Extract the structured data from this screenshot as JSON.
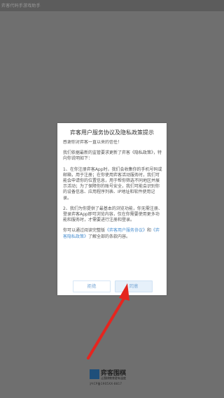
{
  "status_bar": {
    "text": "弈客代码手游戏助手"
  },
  "dialog": {
    "title": "弈客用户服务协议及隐私政策提示",
    "greeting": "感谢你对弈客一直以来的信任！",
    "intro": "我们依据最新的监管要求更新了弈客《隐私政策》，特向你说明如下：",
    "item1": "1、在你注册弈客App时，我们会收集你的手机号码或邮箱，用于注册；在你使用弈客活动服务时，我们可能会申请你的位置信息，用于帮你筛选不同地区并展示活动；为了保障你的账号安全，我们可能会识别你的设备信息、应用程序列表、IP地址和软件使用记录。",
    "item2": "2、我们为你提供了最基本的浏览功能，你无需注册、登录弈客App即可浏览内容，仅在你需要使用更多功能和服务时，才需要进行注册和登录。",
    "outro_prefix": "你可以通过阅读完整版",
    "outro_link1": "《弈客用户服务协议》",
    "outro_and": "和",
    "outro_link2": "《弈客隐私政策》",
    "outro_suffix": "了解全部的条款内容。",
    "reject_label": "拒绝",
    "agree_label": "同意"
  },
  "logo": {
    "name": "弈客围棋",
    "tagline": "让围棋教育更有温度",
    "icp": "沪ICP备1905XX-8817"
  },
  "colors": {
    "accent": "#4a8fd0",
    "arrow": "#e5251f",
    "overlay": "#6f6f6f"
  }
}
